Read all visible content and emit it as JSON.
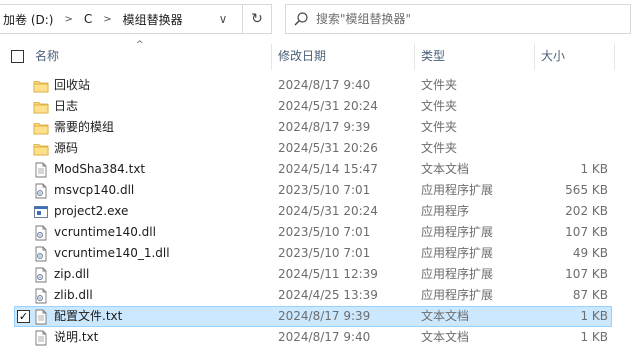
{
  "address": {
    "crumbs": [
      "加卷 (D:)",
      "C",
      "模组替换器"
    ],
    "separator": ">",
    "dropdown": "∨"
  },
  "refresh_glyph": "↻",
  "search": {
    "placeholder": "搜索\"模组替换器\""
  },
  "header": {
    "sort_indicator": "^",
    "name": "名称",
    "date": "修改日期",
    "type": "类型",
    "size": "大小"
  },
  "files": [
    {
      "name": "回收站",
      "date": "2024/8/17 9:40",
      "type": "文件夹",
      "size": "",
      "icon": "folder-icon",
      "selected": false
    },
    {
      "name": "日志",
      "date": "2024/5/31 20:24",
      "type": "文件夹",
      "size": "",
      "icon": "folder-icon",
      "selected": false
    },
    {
      "name": "需要的模组",
      "date": "2024/8/17 9:39",
      "type": "文件夹",
      "size": "",
      "icon": "folder-icon",
      "selected": false
    },
    {
      "name": "源码",
      "date": "2024/5/31 20:26",
      "type": "文件夹",
      "size": "",
      "icon": "folder-icon",
      "selected": false
    },
    {
      "name": "ModSha384.txt",
      "date": "2024/5/14 15:47",
      "type": "文本文档",
      "size": "1 KB",
      "icon": "text-file-icon",
      "selected": false
    },
    {
      "name": "msvcp140.dll",
      "date": "2023/5/10 7:01",
      "type": "应用程序扩展",
      "size": "565 KB",
      "icon": "dll-file-icon",
      "selected": false
    },
    {
      "name": "project2.exe",
      "date": "2024/5/31 20:24",
      "type": "应用程序",
      "size": "202 KB",
      "icon": "exe-file-icon",
      "selected": false
    },
    {
      "name": "vcruntime140.dll",
      "date": "2023/5/10 7:01",
      "type": "应用程序扩展",
      "size": "107 KB",
      "icon": "dll-file-icon",
      "selected": false
    },
    {
      "name": "vcruntime140_1.dll",
      "date": "2023/5/10 7:01",
      "type": "应用程序扩展",
      "size": "49 KB",
      "icon": "dll-file-icon",
      "selected": false
    },
    {
      "name": "zip.dll",
      "date": "2024/5/11 12:39",
      "type": "应用程序扩展",
      "size": "107 KB",
      "icon": "dll-file-icon",
      "selected": false
    },
    {
      "name": "zlib.dll",
      "date": "2024/4/25 13:39",
      "type": "应用程序扩展",
      "size": "87 KB",
      "icon": "dll-file-icon",
      "selected": false
    },
    {
      "name": "配置文件.txt",
      "date": "2024/8/17 9:39",
      "type": "文本文档",
      "size": "1 KB",
      "icon": "text-file-icon",
      "selected": true,
      "check_mark": "✓"
    },
    {
      "name": "说明.txt",
      "date": "2024/8/17 9:40",
      "type": "文本文档",
      "size": "1 KB",
      "icon": "text-file-icon",
      "selected": false
    }
  ]
}
